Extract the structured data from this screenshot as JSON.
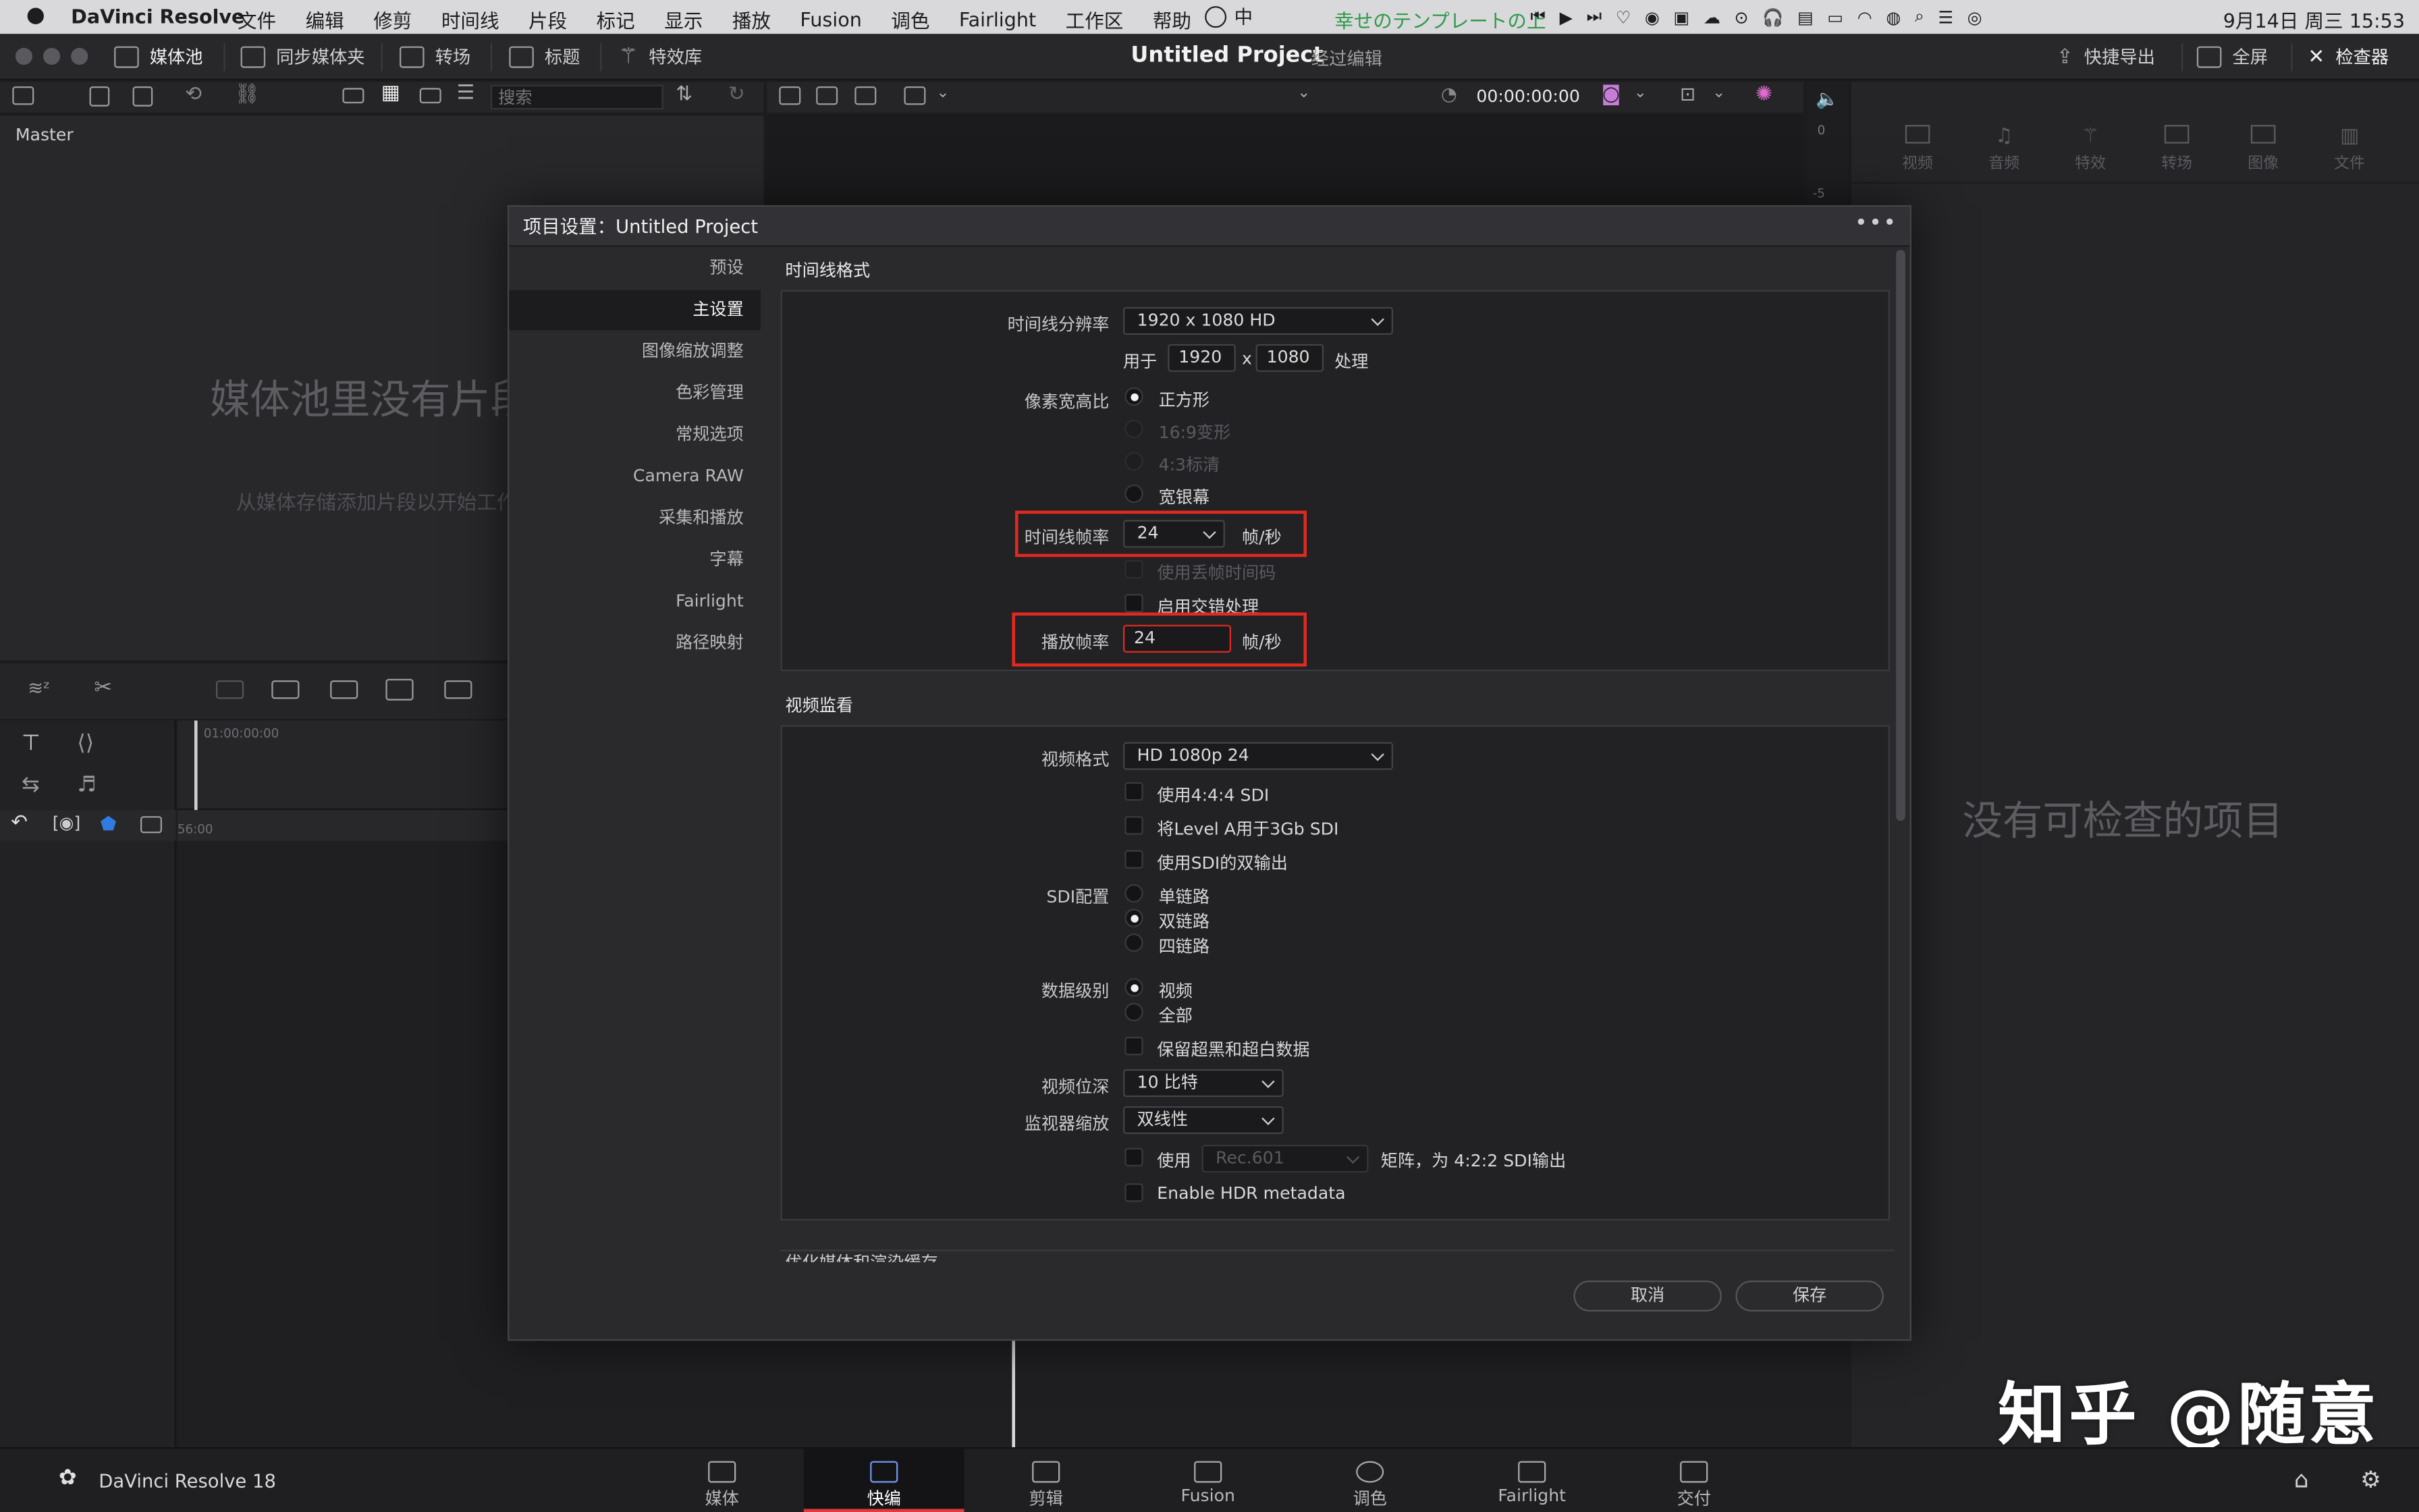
{
  "menubar": {
    "app_name": "DaVinci Resolve",
    "items": [
      "文件",
      "编辑",
      "修剪",
      "时间线",
      "片段",
      "标记",
      "显示",
      "播放",
      "Fusion",
      "调色",
      "Fairlight",
      "工作区",
      "帮助"
    ],
    "now_playing": "幸せのテンプレートの上",
    "date_time": "9月14日 周三  15:53",
    "input_method": "中"
  },
  "toolbar": {
    "media_pool": "媒体池",
    "sync_bin": "同步媒体夹",
    "transitions": "转场",
    "titles": "标题",
    "effects": "特效库",
    "project_title": "Untitled Project",
    "project_subtitle": "经过编辑",
    "quick_export": "快捷导出",
    "fullscreen": "全屏",
    "inspector": "检查器"
  },
  "media_pool": {
    "search_placeholder": "搜索",
    "bin": "Master",
    "empty_title": "媒体池里没有片段",
    "empty_hint": "从媒体存储添加片段以开始工作"
  },
  "viewer": {
    "timecode": "00:00:00:00",
    "audio_levels": [
      "0",
      "-5"
    ]
  },
  "timeline": {
    "ruler_start": "01:00:00:00",
    "ruler_second": "56:00"
  },
  "inspector": {
    "tabs": [
      "视频",
      "音频",
      "特效",
      "转场",
      "图像",
      "文件"
    ],
    "empty_text": "没有可检查的项目"
  },
  "dialog": {
    "title": "项目设置：Untitled Project",
    "nav": [
      "预设",
      "主设置",
      "图像缩放调整",
      "色彩管理",
      "常规选项",
      "Camera RAW",
      "采集和播放",
      "字幕",
      "Fairlight",
      "路径映射"
    ],
    "active_nav": "主设置",
    "timeline_format": {
      "title": "时间线格式",
      "resolution_label": "时间线分辨率",
      "resolution_value": "1920 x 1080 HD",
      "for_label": "用于",
      "width": "1920",
      "x": "x",
      "height": "1080",
      "process_label": "处理",
      "aspect_label": "像素宽高比",
      "aspect_options": [
        "正方形",
        "16:9变形",
        "4:3标清",
        "宽银幕"
      ],
      "frame_rate_label": "时间线帧率",
      "frame_rate_value": "24",
      "fps_unit": "帧/秒",
      "drop_frame": "使用丢帧时间码",
      "interlace": "启用交错处理",
      "playback_label": "播放帧率",
      "playback_value": "24",
      "playback_unit": "帧/秒"
    },
    "video_monitoring": {
      "title": "视频监看",
      "format_label": "视频格式",
      "format_value": "HD 1080p 24",
      "opt_444": "使用4:4:4 SDI",
      "opt_level_a": "将Level A用于3Gb SDI",
      "opt_dual": "使用SDI的双输出",
      "sdi_label": "SDI配置",
      "sdi_options": [
        "单链路",
        "双链路",
        "四链路"
      ],
      "data_label": "数据级别",
      "data_options": [
        "视频",
        "全部"
      ],
      "retain": "保留超黑和超白数据",
      "bit_depth_label": "视频位深",
      "bit_depth_value": "10 比特",
      "scaling_label": "监视器缩放",
      "scaling_value": "双线性",
      "use_label": "使用",
      "matrix_value": "Rec.601",
      "matrix_suffix": "矩阵，为 4:2:2 SDI输出",
      "hdr": "Enable HDR metadata"
    },
    "next_section": "优化媒体和渲染缓存",
    "cancel": "取消",
    "save": "保存"
  },
  "pages": [
    "媒体",
    "快编",
    "剪辑",
    "Fusion",
    "调色",
    "Fairlight",
    "交付"
  ],
  "active_page": "快编",
  "brand": "DaVinci Resolve 18",
  "watermark": "知乎 @随意"
}
